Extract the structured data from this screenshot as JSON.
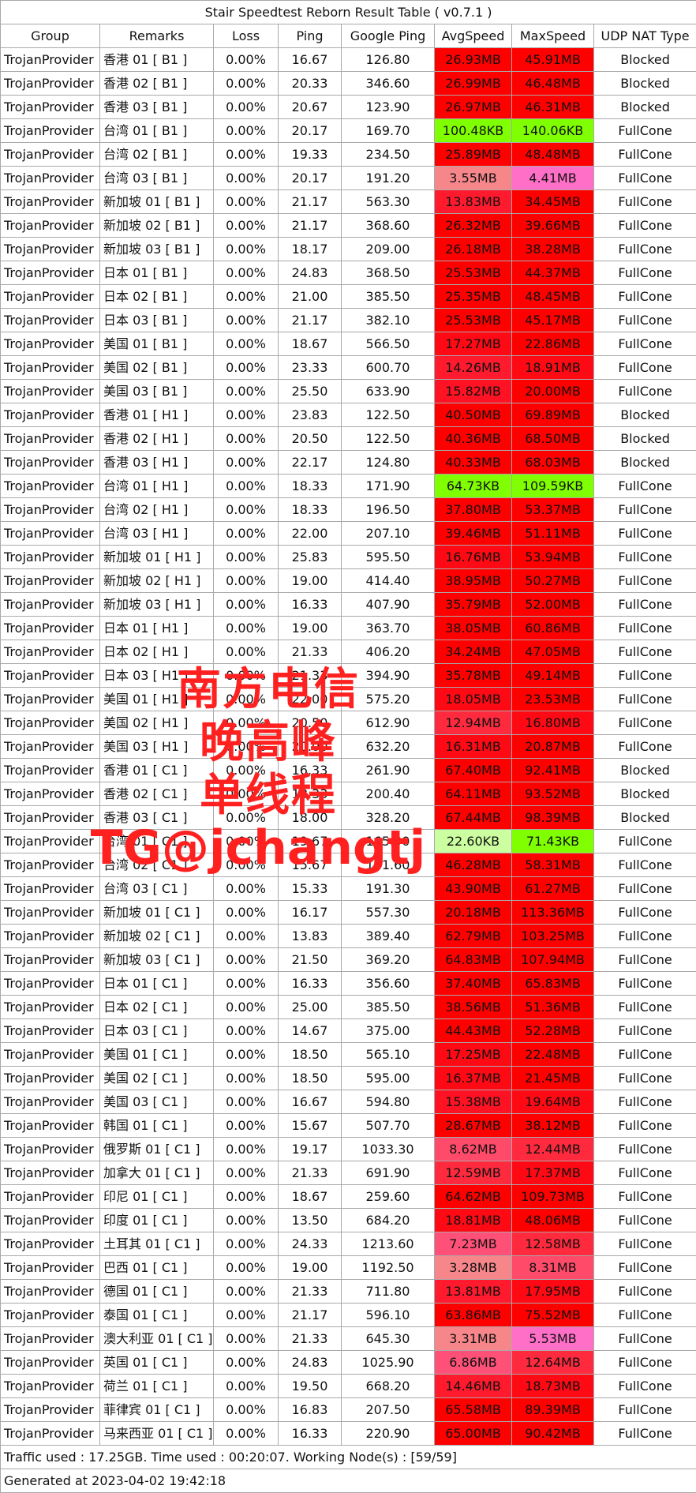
{
  "title": "Stair Speedtest Reborn Result Table ( v0.7.1 )",
  "headers": [
    "Group",
    "Remarks",
    "Loss",
    "Ping",
    "Google Ping",
    "AvgSpeed",
    "MaxSpeed",
    "UDP NAT Type"
  ],
  "rows": [
    {
      "group": "TrojanProvider",
      "remarks": "香港 01 [ B1 ]",
      "loss": "0.00%",
      "ping": "16.67",
      "gping": "126.80",
      "avg": "26.93MB",
      "max": "45.91MB",
      "nat": "Blocked",
      "avgColor": "#ff0000",
      "maxColor": "#ff0000"
    },
    {
      "group": "TrojanProvider",
      "remarks": "香港 02 [ B1 ]",
      "loss": "0.00%",
      "ping": "20.33",
      "gping": "346.60",
      "avg": "26.99MB",
      "max": "46.48MB",
      "nat": "Blocked",
      "avgColor": "#ff0000",
      "maxColor": "#ff0000"
    },
    {
      "group": "TrojanProvider",
      "remarks": "香港 03 [ B1 ]",
      "loss": "0.00%",
      "ping": "20.67",
      "gping": "123.90",
      "avg": "26.97MB",
      "max": "46.31MB",
      "nat": "Blocked",
      "avgColor": "#ff0000",
      "maxColor": "#ff0000"
    },
    {
      "group": "TrojanProvider",
      "remarks": "台湾 01 [ B1 ]",
      "loss": "0.00%",
      "ping": "20.17",
      "gping": "169.70",
      "avg": "100.48KB",
      "max": "140.06KB",
      "nat": "FullCone",
      "avgColor": "#7fff00",
      "maxColor": "#7fff00"
    },
    {
      "group": "TrojanProvider",
      "remarks": "台湾 02 [ B1 ]",
      "loss": "0.00%",
      "ping": "19.33",
      "gping": "234.50",
      "avg": "25.89MB",
      "max": "48.48MB",
      "nat": "FullCone",
      "avgColor": "#ff0000",
      "maxColor": "#ff0000"
    },
    {
      "group": "TrojanProvider",
      "remarks": "台湾 03 [ B1 ]",
      "loss": "0.00%",
      "ping": "20.17",
      "gping": "191.20",
      "avg": "3.55MB",
      "max": "4.41MB",
      "nat": "FullCone",
      "avgColor": "#f7868b",
      "maxColor": "#ff6ec7"
    },
    {
      "group": "TrojanProvider",
      "remarks": "新加坡 01 [ B1 ]",
      "loss": "0.00%",
      "ping": "21.17",
      "gping": "563.30",
      "avg": "13.83MB",
      "max": "34.45MB",
      "nat": "FullCone",
      "avgColor": "#ff1a2e",
      "maxColor": "#ff0000"
    },
    {
      "group": "TrojanProvider",
      "remarks": "新加坡 02 [ B1 ]",
      "loss": "0.00%",
      "ping": "21.17",
      "gping": "368.60",
      "avg": "26.32MB",
      "max": "39.66MB",
      "nat": "FullCone",
      "avgColor": "#ff0000",
      "maxColor": "#ff0000"
    },
    {
      "group": "TrojanProvider",
      "remarks": "新加坡 03 [ B1 ]",
      "loss": "0.00%",
      "ping": "18.17",
      "gping": "209.00",
      "avg": "26.18MB",
      "max": "38.28MB",
      "nat": "FullCone",
      "avgColor": "#ff0000",
      "maxColor": "#ff0000"
    },
    {
      "group": "TrojanProvider",
      "remarks": "日本 01 [ B1 ]",
      "loss": "0.00%",
      "ping": "24.83",
      "gping": "368.50",
      "avg": "25.53MB",
      "max": "44.37MB",
      "nat": "FullCone",
      "avgColor": "#ff0000",
      "maxColor": "#ff0000"
    },
    {
      "group": "TrojanProvider",
      "remarks": "日本 02 [ B1 ]",
      "loss": "0.00%",
      "ping": "21.00",
      "gping": "385.50",
      "avg": "25.35MB",
      "max": "48.45MB",
      "nat": "FullCone",
      "avgColor": "#ff0000",
      "maxColor": "#ff0000"
    },
    {
      "group": "TrojanProvider",
      "remarks": "日本 03 [ B1 ]",
      "loss": "0.00%",
      "ping": "21.17",
      "gping": "382.10",
      "avg": "25.53MB",
      "max": "45.17MB",
      "nat": "FullCone",
      "avgColor": "#ff0000",
      "maxColor": "#ff0000"
    },
    {
      "group": "TrojanProvider",
      "remarks": "美国 01 [ B1 ]",
      "loss": "0.00%",
      "ping": "18.67",
      "gping": "566.50",
      "avg": "17.27MB",
      "max": "22.86MB",
      "nat": "FullCone",
      "avgColor": "#ff0a14",
      "maxColor": "#ff0000"
    },
    {
      "group": "TrojanProvider",
      "remarks": "美国 02 [ B1 ]",
      "loss": "0.00%",
      "ping": "23.33",
      "gping": "600.70",
      "avg": "14.26MB",
      "max": "18.91MB",
      "nat": "FullCone",
      "avgColor": "#ff1a2e",
      "maxColor": "#ff0a14"
    },
    {
      "group": "TrojanProvider",
      "remarks": "美国 03 [ B1 ]",
      "loss": "0.00%",
      "ping": "25.50",
      "gping": "633.90",
      "avg": "15.82MB",
      "max": "20.00MB",
      "nat": "FullCone",
      "avgColor": "#ff1224",
      "maxColor": "#ff0000"
    },
    {
      "group": "TrojanProvider",
      "remarks": "香港 01 [ H1 ]",
      "loss": "0.00%",
      "ping": "23.83",
      "gping": "122.50",
      "avg": "40.50MB",
      "max": "69.89MB",
      "nat": "Blocked",
      "avgColor": "#ff0000",
      "maxColor": "#ff0000"
    },
    {
      "group": "TrojanProvider",
      "remarks": "香港 02 [ H1 ]",
      "loss": "0.00%",
      "ping": "20.50",
      "gping": "122.50",
      "avg": "40.36MB",
      "max": "68.50MB",
      "nat": "Blocked",
      "avgColor": "#ff0000",
      "maxColor": "#ff0000"
    },
    {
      "group": "TrojanProvider",
      "remarks": "香港 03 [ H1 ]",
      "loss": "0.00%",
      "ping": "22.17",
      "gping": "124.80",
      "avg": "40.33MB",
      "max": "68.03MB",
      "nat": "Blocked",
      "avgColor": "#ff0000",
      "maxColor": "#ff0000"
    },
    {
      "group": "TrojanProvider",
      "remarks": "台湾 01 [ H1 ]",
      "loss": "0.00%",
      "ping": "18.33",
      "gping": "171.90",
      "avg": "64.73KB",
      "max": "109.59KB",
      "nat": "FullCone",
      "avgColor": "#7fff00",
      "maxColor": "#7fff00"
    },
    {
      "group": "TrojanProvider",
      "remarks": "台湾 02 [ H1 ]",
      "loss": "0.00%",
      "ping": "18.33",
      "gping": "196.50",
      "avg": "37.80MB",
      "max": "53.37MB",
      "nat": "FullCone",
      "avgColor": "#ff0000",
      "maxColor": "#ff0000"
    },
    {
      "group": "TrojanProvider",
      "remarks": "台湾 03 [ H1 ]",
      "loss": "0.00%",
      "ping": "22.00",
      "gping": "207.10",
      "avg": "39.46MB",
      "max": "51.11MB",
      "nat": "FullCone",
      "avgColor": "#ff0000",
      "maxColor": "#ff0000"
    },
    {
      "group": "TrojanProvider",
      "remarks": "新加坡 01 [ H1 ]",
      "loss": "0.00%",
      "ping": "25.83",
      "gping": "595.50",
      "avg": "16.76MB",
      "max": "53.94MB",
      "nat": "FullCone",
      "avgColor": "#ff0a14",
      "maxColor": "#ff0000"
    },
    {
      "group": "TrojanProvider",
      "remarks": "新加坡 02 [ H1 ]",
      "loss": "0.00%",
      "ping": "19.00",
      "gping": "414.40",
      "avg": "38.95MB",
      "max": "50.27MB",
      "nat": "FullCone",
      "avgColor": "#ff0000",
      "maxColor": "#ff0000"
    },
    {
      "group": "TrojanProvider",
      "remarks": "新加坡 03 [ H1 ]",
      "loss": "0.00%",
      "ping": "16.33",
      "gping": "407.90",
      "avg": "35.79MB",
      "max": "52.00MB",
      "nat": "FullCone",
      "avgColor": "#ff0000",
      "maxColor": "#ff0000"
    },
    {
      "group": "TrojanProvider",
      "remarks": "日本 01 [ H1 ]",
      "loss": "0.00%",
      "ping": "19.00",
      "gping": "363.70",
      "avg": "38.05MB",
      "max": "60.86MB",
      "nat": "FullCone",
      "avgColor": "#ff0000",
      "maxColor": "#ff0000"
    },
    {
      "group": "TrojanProvider",
      "remarks": "日本 02 [ H1 ]",
      "loss": "0.00%",
      "ping": "21.33",
      "gping": "406.20",
      "avg": "34.24MB",
      "max": "47.05MB",
      "nat": "FullCone",
      "avgColor": "#ff0000",
      "maxColor": "#ff0000"
    },
    {
      "group": "TrojanProvider",
      "remarks": "日本 03 [ H1 ]",
      "loss": "0.00%",
      "ping": "21.33",
      "gping": "394.90",
      "avg": "35.78MB",
      "max": "49.14MB",
      "nat": "FullCone",
      "avgColor": "#ff0000",
      "maxColor": "#ff0000"
    },
    {
      "group": "TrojanProvider",
      "remarks": "美国 01 [ H1 ]",
      "loss": "0.00%",
      "ping": "22.00",
      "gping": "575.20",
      "avg": "18.05MB",
      "max": "23.53MB",
      "nat": "FullCone",
      "avgColor": "#ff0a14",
      "maxColor": "#ff0000"
    },
    {
      "group": "TrojanProvider",
      "remarks": "美国 02 [ H1 ]",
      "loss": "0.00%",
      "ping": "20.50",
      "gping": "612.90",
      "avg": "12.94MB",
      "max": "16.80MB",
      "nat": "FullCone",
      "avgColor": "#ff2a3e",
      "maxColor": "#ff0a14"
    },
    {
      "group": "TrojanProvider",
      "remarks": "美国 03 [ H1 ]",
      "loss": "0.00%",
      "ping": "20.00",
      "gping": "632.20",
      "avg": "16.31MB",
      "max": "20.87MB",
      "nat": "FullCone",
      "avgColor": "#ff0a14",
      "maxColor": "#ff0000"
    },
    {
      "group": "TrojanProvider",
      "remarks": "香港 01 [ C1 ]",
      "loss": "0.00%",
      "ping": "16.33",
      "gping": "261.90",
      "avg": "67.40MB",
      "max": "92.41MB",
      "nat": "Blocked",
      "avgColor": "#ff0000",
      "maxColor": "#ff0000"
    },
    {
      "group": "TrojanProvider",
      "remarks": "香港 02 [ C1 ]",
      "loss": "0.00%",
      "ping": "18.33",
      "gping": "200.40",
      "avg": "64.11MB",
      "max": "93.52MB",
      "nat": "Blocked",
      "avgColor": "#ff0000",
      "maxColor": "#ff0000"
    },
    {
      "group": "TrojanProvider",
      "remarks": "香港 03 [ C1 ]",
      "loss": "0.00%",
      "ping": "18.00",
      "gping": "328.20",
      "avg": "67.44MB",
      "max": "98.39MB",
      "nat": "Blocked",
      "avgColor": "#ff0000",
      "maxColor": "#ff0000"
    },
    {
      "group": "TrojanProvider",
      "remarks": "台湾 01 [ C1 ]",
      "loss": "0.00%",
      "ping": "19.67",
      "gping": "165.90",
      "avg": "22.60KB",
      "max": "71.43KB",
      "nat": "FullCone",
      "avgColor": "#ccffa0",
      "maxColor": "#7fff00"
    },
    {
      "group": "TrojanProvider",
      "remarks": "台湾 02 [ C1 ]",
      "loss": "0.00%",
      "ping": "15.67",
      "gping": "191.60",
      "avg": "46.28MB",
      "max": "58.31MB",
      "nat": "FullCone",
      "avgColor": "#ff0000",
      "maxColor": "#ff0000"
    },
    {
      "group": "TrojanProvider",
      "remarks": "台湾 03 [ C1 ]",
      "loss": "0.00%",
      "ping": "15.33",
      "gping": "191.30",
      "avg": "43.90MB",
      "max": "61.27MB",
      "nat": "FullCone",
      "avgColor": "#ff0000",
      "maxColor": "#ff0000"
    },
    {
      "group": "TrojanProvider",
      "remarks": "新加坡 01 [ C1 ]",
      "loss": "0.00%",
      "ping": "16.17",
      "gping": "557.30",
      "avg": "20.18MB",
      "max": "113.36MB",
      "nat": "FullCone",
      "avgColor": "#ff0000",
      "maxColor": "#ff0000"
    },
    {
      "group": "TrojanProvider",
      "remarks": "新加坡 02 [ C1 ]",
      "loss": "0.00%",
      "ping": "13.83",
      "gping": "389.40",
      "avg": "62.79MB",
      "max": "103.25MB",
      "nat": "FullCone",
      "avgColor": "#ff0000",
      "maxColor": "#ff0000"
    },
    {
      "group": "TrojanProvider",
      "remarks": "新加坡 03 [ C1 ]",
      "loss": "0.00%",
      "ping": "21.50",
      "gping": "369.20",
      "avg": "64.83MB",
      "max": "107.94MB",
      "nat": "FullCone",
      "avgColor": "#ff0000",
      "maxColor": "#ff0000"
    },
    {
      "group": "TrojanProvider",
      "remarks": "日本 01 [ C1 ]",
      "loss": "0.00%",
      "ping": "16.33",
      "gping": "356.60",
      "avg": "37.40MB",
      "max": "65.83MB",
      "nat": "FullCone",
      "avgColor": "#ff0000",
      "maxColor": "#ff0000"
    },
    {
      "group": "TrojanProvider",
      "remarks": "日本 02 [ C1 ]",
      "loss": "0.00%",
      "ping": "25.00",
      "gping": "385.50",
      "avg": "38.56MB",
      "max": "51.36MB",
      "nat": "FullCone",
      "avgColor": "#ff0000",
      "maxColor": "#ff0000"
    },
    {
      "group": "TrojanProvider",
      "remarks": "日本 03 [ C1 ]",
      "loss": "0.00%",
      "ping": "14.67",
      "gping": "375.00",
      "avg": "44.43MB",
      "max": "52.28MB",
      "nat": "FullCone",
      "avgColor": "#ff0000",
      "maxColor": "#ff0000"
    },
    {
      "group": "TrojanProvider",
      "remarks": "美国 01 [ C1 ]",
      "loss": "0.00%",
      "ping": "18.50",
      "gping": "565.10",
      "avg": "17.25MB",
      "max": "22.48MB",
      "nat": "FullCone",
      "avgColor": "#ff0a14",
      "maxColor": "#ff0000"
    },
    {
      "group": "TrojanProvider",
      "remarks": "美国 02 [ C1 ]",
      "loss": "0.00%",
      "ping": "18.50",
      "gping": "595.00",
      "avg": "16.37MB",
      "max": "21.45MB",
      "nat": "FullCone",
      "avgColor": "#ff0a14",
      "maxColor": "#ff0000"
    },
    {
      "group": "TrojanProvider",
      "remarks": "美国 03 [ C1 ]",
      "loss": "0.00%",
      "ping": "16.67",
      "gping": "594.80",
      "avg": "15.38MB",
      "max": "19.64MB",
      "nat": "FullCone",
      "avgColor": "#ff1224",
      "maxColor": "#ff0a14"
    },
    {
      "group": "TrojanProvider",
      "remarks": "韩国 01 [ C1 ]",
      "loss": "0.00%",
      "ping": "15.67",
      "gping": "507.70",
      "avg": "28.67MB",
      "max": "38.12MB",
      "nat": "FullCone",
      "avgColor": "#ff0000",
      "maxColor": "#ff0000"
    },
    {
      "group": "TrojanProvider",
      "remarks": "俄罗斯 01 [ C1 ]",
      "loss": "0.00%",
      "ping": "19.17",
      "gping": "1033.30",
      "avg": "8.62MB",
      "max": "12.44MB",
      "nat": "FullCone",
      "avgColor": "#ff4a6a",
      "maxColor": "#ff2a3e"
    },
    {
      "group": "TrojanProvider",
      "remarks": "加拿大 01 [ C1 ]",
      "loss": "0.00%",
      "ping": "21.33",
      "gping": "691.90",
      "avg": "12.59MB",
      "max": "17.37MB",
      "nat": "FullCone",
      "avgColor": "#ff2a3e",
      "maxColor": "#ff0a14"
    },
    {
      "group": "TrojanProvider",
      "remarks": "印尼 01 [ C1 ]",
      "loss": "0.00%",
      "ping": "18.67",
      "gping": "259.60",
      "avg": "64.62MB",
      "max": "109.73MB",
      "nat": "FullCone",
      "avgColor": "#ff0000",
      "maxColor": "#ff0000"
    },
    {
      "group": "TrojanProvider",
      "remarks": "印度 01 [ C1 ]",
      "loss": "0.00%",
      "ping": "13.50",
      "gping": "684.20",
      "avg": "18.81MB",
      "max": "48.06MB",
      "nat": "FullCone",
      "avgColor": "#ff0a14",
      "maxColor": "#ff0000"
    },
    {
      "group": "TrojanProvider",
      "remarks": "土耳其 01 [ C1 ]",
      "loss": "0.00%",
      "ping": "24.33",
      "gping": "1213.60",
      "avg": "7.23MB",
      "max": "12.58MB",
      "nat": "FullCone",
      "avgColor": "#ff5078",
      "maxColor": "#ff2a3e"
    },
    {
      "group": "TrojanProvider",
      "remarks": "巴西 01 [ C1 ]",
      "loss": "0.00%",
      "ping": "19.00",
      "gping": "1192.50",
      "avg": "3.28MB",
      "max": "8.31MB",
      "nat": "FullCone",
      "avgColor": "#f7868b",
      "maxColor": "#ff4a6a"
    },
    {
      "group": "TrojanProvider",
      "remarks": "德国 01 [ C1 ]",
      "loss": "0.00%",
      "ping": "21.33",
      "gping": "711.80",
      "avg": "13.81MB",
      "max": "17.95MB",
      "nat": "FullCone",
      "avgColor": "#ff1a2e",
      "maxColor": "#ff0a14"
    },
    {
      "group": "TrojanProvider",
      "remarks": "泰国 01 [ C1 ]",
      "loss": "0.00%",
      "ping": "21.17",
      "gping": "596.10",
      "avg": "63.86MB",
      "max": "75.52MB",
      "nat": "FullCone",
      "avgColor": "#ff0000",
      "maxColor": "#ff0000"
    },
    {
      "group": "TrojanProvider",
      "remarks": "澳大利亚 01 [ C1 ]",
      "loss": "0.00%",
      "ping": "21.33",
      "gping": "645.30",
      "avg": "3.31MB",
      "max": "5.53MB",
      "nat": "FullCone",
      "avgColor": "#f7868b",
      "maxColor": "#ff6ec7"
    },
    {
      "group": "TrojanProvider",
      "remarks": "英国 01 [ C1 ]",
      "loss": "0.00%",
      "ping": "24.83",
      "gping": "1025.90",
      "avg": "6.86MB",
      "max": "12.64MB",
      "nat": "FullCone",
      "avgColor": "#ff5078",
      "maxColor": "#ff2a3e"
    },
    {
      "group": "TrojanProvider",
      "remarks": "荷兰 01 [ C1 ]",
      "loss": "0.00%",
      "ping": "19.50",
      "gping": "668.20",
      "avg": "14.46MB",
      "max": "18.73MB",
      "nat": "FullCone",
      "avgColor": "#ff1a2e",
      "maxColor": "#ff0a14"
    },
    {
      "group": "TrojanProvider",
      "remarks": "菲律宾 01 [ C1 ]",
      "loss": "0.00%",
      "ping": "16.83",
      "gping": "207.50",
      "avg": "65.58MB",
      "max": "89.39MB",
      "nat": "FullCone",
      "avgColor": "#ff0000",
      "maxColor": "#ff0000"
    },
    {
      "group": "TrojanProvider",
      "remarks": "马来西亚 01 [ C1 ]",
      "loss": "0.00%",
      "ping": "16.33",
      "gping": "220.90",
      "avg": "65.00MB",
      "max": "90.42MB",
      "nat": "FullCone",
      "avgColor": "#ff0000",
      "maxColor": "#ff0000"
    }
  ],
  "footer": {
    "traffic": "Traffic used : 17.25GB. Time used : 00:20:07. Working Node(s) : [59/59]",
    "generated": "Generated at 2023-04-02 19:42:18"
  },
  "watermark": {
    "line1": "南方电信",
    "line2": "晚高峰",
    "line3": "单线程",
    "line4": "TG@jchangtj",
    "color": "#ff2020"
  }
}
